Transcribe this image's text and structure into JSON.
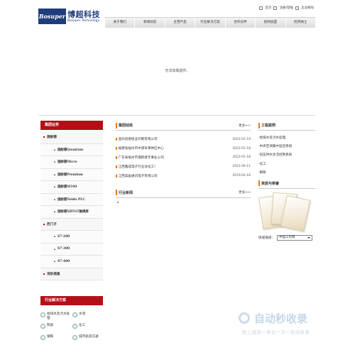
{
  "header": {
    "logo_text": "Bosuper",
    "brand_cn": "博超科技",
    "brand_en": "Bosuper Technology",
    "top_links": [
      "首页",
      "注册/登陆",
      "企业邮局"
    ]
  },
  "nav": {
    "items": [
      "关于我们",
      "新闻动态",
      "主营产品",
      "行业解决方案",
      "合作伙伴",
      "招商加盟",
      "招贤纳士"
    ]
  },
  "plugin_message": "无法加载插件。",
  "left": {
    "group_title": "集团业务",
    "menu": [
      {
        "label": "施耐德",
        "level": 1
      },
      {
        "label": "施耐德Quantum",
        "level": 2
      },
      {
        "label": "施耐德Micro",
        "level": 2
      },
      {
        "label": "施耐德Premium",
        "level": 2
      },
      {
        "label": "施耐德M340",
        "level": 2
      },
      {
        "label": "施耐德Twido PLC",
        "level": 2
      },
      {
        "label": "施耐德XBTGT触摸屏",
        "level": 2
      },
      {
        "label": "西门子",
        "level": 1
      },
      {
        "label": "S7-200",
        "level": 2
      },
      {
        "label": "S7-300",
        "level": 2
      },
      {
        "label": "S7-400",
        "level": 2
      },
      {
        "label": "消防措施",
        "level": 1
      }
    ],
    "solutions_title": "行业解决方案",
    "solutions": [
      "给排水及污水处理",
      "水泥",
      "陶瓷",
      "化工",
      "钢铁",
      "城市轨道交通"
    ]
  },
  "news": {
    "title": "集团动态",
    "more": "更多>>",
    "items": [
      {
        "title": "温州昌德纸业印刷有限公司",
        "date": "2022-01-19"
      },
      {
        "title": "福建省福州市中渡军事供应中心",
        "date": "2022-01-18"
      },
      {
        "title": "广东省福州市潮新建丰事业公司",
        "date": "2022-01-18"
      },
      {
        "title": "江西鑫成电子行业净化工！",
        "date": "2021-06-11"
      },
      {
        "title": "江西美居通讯电子有限公司",
        "date": "2019-02-16"
      }
    ]
  },
  "industry": {
    "title": "行业新闻",
    "more": "更多>>"
  },
  "cases": {
    "title": "工程案例",
    "items": [
      "·给排水及污水处理",
      "·中央空调集中监控系统",
      "·恒压供水生活控制系统",
      "·化工",
      "·钢铁"
    ]
  },
  "honors": {
    "title": "资质与荣誉"
  },
  "quick_link": {
    "label": "快速链接：",
    "selected": "中国工控网"
  },
  "watermark": {
    "name": "自动秒收录",
    "sub": "数上链接一来访一次一自动收录"
  }
}
